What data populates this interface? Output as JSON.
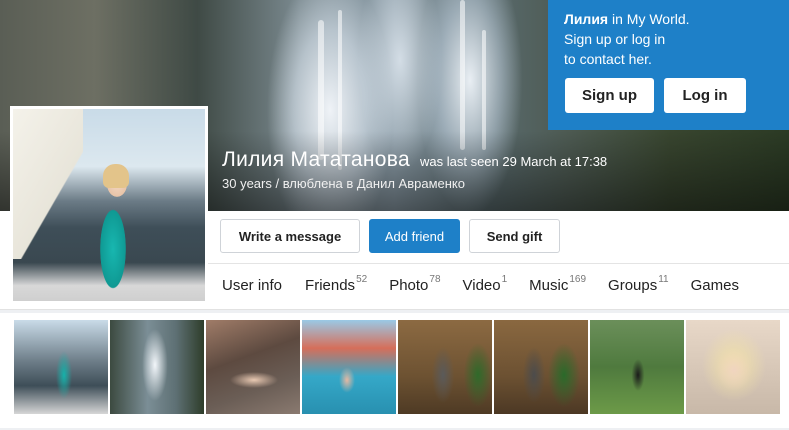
{
  "login": {
    "name": "Лилия",
    "line1_rest": " in My World.",
    "line2": "Sign up or log in",
    "line3": "to contact her.",
    "signup_label": "Sign up",
    "login_label": "Log in"
  },
  "profile": {
    "name": "Лилия Мататанова",
    "last_seen": "was last seen 29 March at 17:38",
    "details": "30 years / влюблена в Данил Авраменко"
  },
  "actions": {
    "write_message": "Write a message",
    "add_friend": "Add friend",
    "send_gift": "Send gift"
  },
  "tabs": [
    {
      "label": "User info",
      "count": ""
    },
    {
      "label": "Friends",
      "count": "52"
    },
    {
      "label": "Photo",
      "count": "78"
    },
    {
      "label": "Video",
      "count": "1"
    },
    {
      "label": "Music",
      "count": "169"
    },
    {
      "label": "Groups",
      "count": "11"
    },
    {
      "label": "Games",
      "count": ""
    }
  ],
  "colors": {
    "accent": "#1e80c8"
  }
}
